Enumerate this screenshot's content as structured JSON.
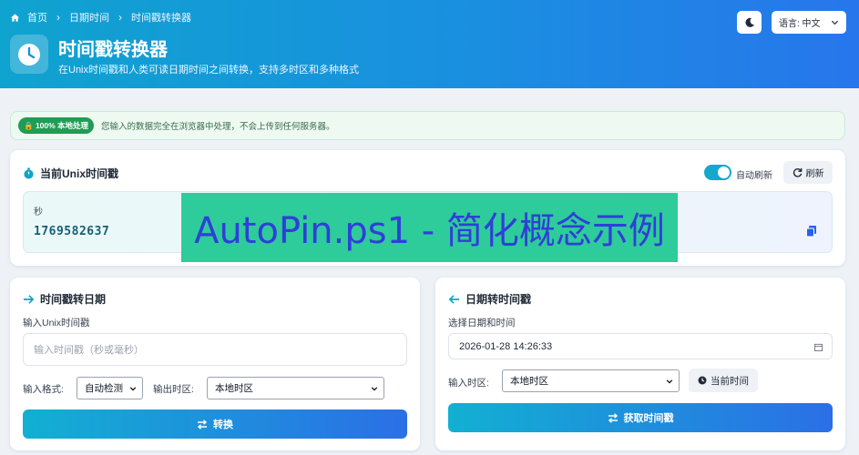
{
  "breadcrumb": {
    "home": "首页",
    "datetime": "日期时间",
    "current": "时间戳转换器"
  },
  "app": {
    "title": "时间戳转换器",
    "subtitle": "在Unix时间戳和人类可读日期时间之间转换，支持多时区和多种格式"
  },
  "header": {
    "language_label": "语言: 中文"
  },
  "notice": {
    "badge": "🔒 100% 本地处理",
    "text": "您输入的数据完全在浏览器中处理，不会上传到任何服务器。"
  },
  "current": {
    "title": "当前Unix时间戳",
    "auto_refresh_label": "自动刷新",
    "refresh_label": "刷新",
    "seconds_label": "秒",
    "seconds_value": "1769582637"
  },
  "ts_to_date": {
    "title": "时间戳转日期",
    "input_label": "输入Unix时间戳",
    "input_placeholder": "输入时间戳（秒或毫秒）",
    "format_label": "输入格式:",
    "format_value": "自动检测",
    "tz_label": "输出时区:",
    "tz_value": "本地时区",
    "button": "转换"
  },
  "date_to_ts": {
    "title": "日期转时间戳",
    "input_label": "选择日期和时间",
    "input_value": "2026-01-28 14:26:33",
    "tz_label": "输入时区:",
    "tz_value": "本地时区",
    "now_button": "当前时间",
    "button": "获取时间戳"
  },
  "overlay": {
    "text": "AutoPin.ps1 - 简化概念示例"
  },
  "colors": {
    "accent": "#14a8cc",
    "brand_gradient_start": "#0fa3cf",
    "brand_gradient_end": "#2776ec",
    "overlay_bg": "#2ecb9b",
    "overlay_text": "#2f3fd8"
  }
}
